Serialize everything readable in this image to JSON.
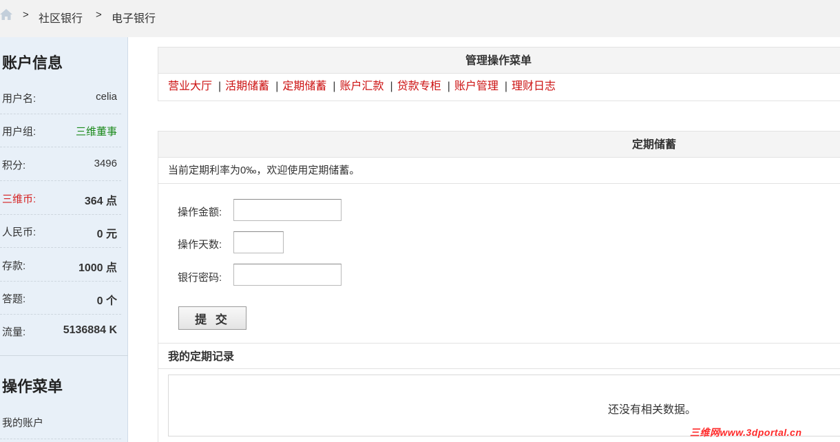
{
  "breadcrumb": {
    "separator": ">",
    "items": [
      "社区银行",
      "电子银行"
    ]
  },
  "sidebar": {
    "account_title": "账户信息",
    "account_rows": [
      {
        "label": "用户名:",
        "value": "celia"
      },
      {
        "label": "用户组:",
        "value": "三维董事"
      },
      {
        "label": "积分:",
        "value": "3496"
      },
      {
        "label": "三维币:",
        "value": "364 点"
      },
      {
        "label": "人民币:",
        "value": "0 元"
      },
      {
        "label": "存款:",
        "value": "1000 点"
      },
      {
        "label": "答题:",
        "value": "0 个"
      },
      {
        "label": "流量:",
        "value": "5136884 K"
      }
    ],
    "menu_title": "操作菜单",
    "menu_items": [
      "我的账户"
    ]
  },
  "manage_panel": {
    "title": "管理操作菜单",
    "separator": "|",
    "links": [
      "营业大厅",
      "活期储蓄",
      "定期储蓄",
      "账户汇款",
      "贷款专柜",
      "账户管理",
      "理财日志"
    ]
  },
  "deposit_panel": {
    "title": "定期储蓄",
    "info": "当前定期利率为0‰，欢迎使用定期储蓄。",
    "fields": {
      "amount_label": "操作金额:",
      "amount_value": "",
      "days_label": "操作天数:",
      "days_value": "",
      "password_label": "银行密码:",
      "password_value": ""
    },
    "submit_label": "提 交",
    "records_title": "我的定期记录",
    "records_empty": "还没有相关数据。"
  },
  "watermark": "三维网www.3dportal.cn",
  "colors": {
    "link_red": "#cc1111",
    "group_green": "#1c8a1c",
    "sidebar_bg": "#e8f0f8"
  }
}
